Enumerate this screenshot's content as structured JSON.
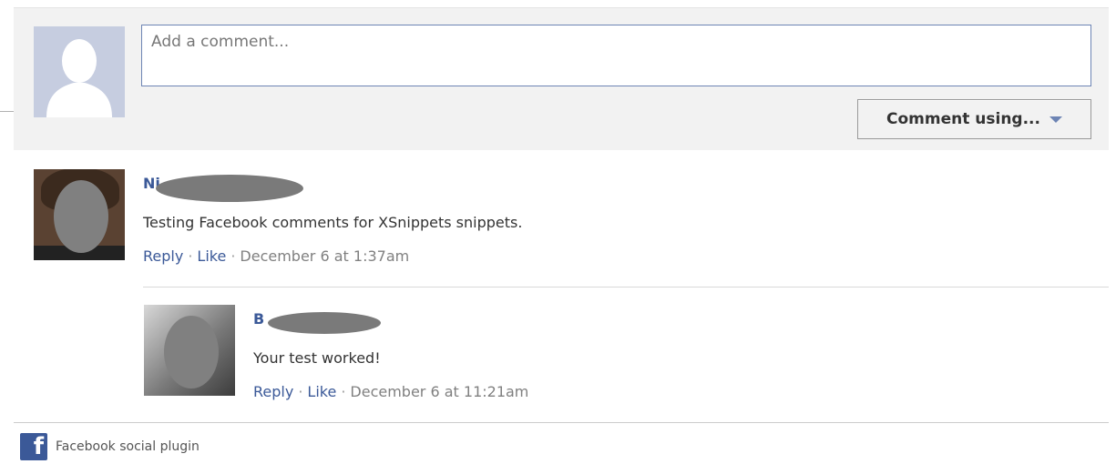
{
  "composer": {
    "placeholder": "Add a comment...",
    "submit_label": "Comment using...",
    "avatar_icon": "silhouette-icon"
  },
  "comments": [
    {
      "author": "Ni",
      "text": "Testing Facebook comments for XSnippets snippets.",
      "reply_label": "Reply",
      "like_label": "Like",
      "separator": "·",
      "date": "December 6 at 1:37am"
    },
    {
      "author": "B",
      "text": "Your test worked!",
      "reply_label": "Reply",
      "like_label": "Like",
      "separator": "·",
      "date": "December 6 at 11:21am"
    }
  ],
  "footer": {
    "label": "Facebook social plugin",
    "icon": "facebook-f-icon"
  },
  "colors": {
    "link": "#3b5998",
    "input_border": "#6d84b4",
    "composer_bg": "#f2f2f2"
  }
}
